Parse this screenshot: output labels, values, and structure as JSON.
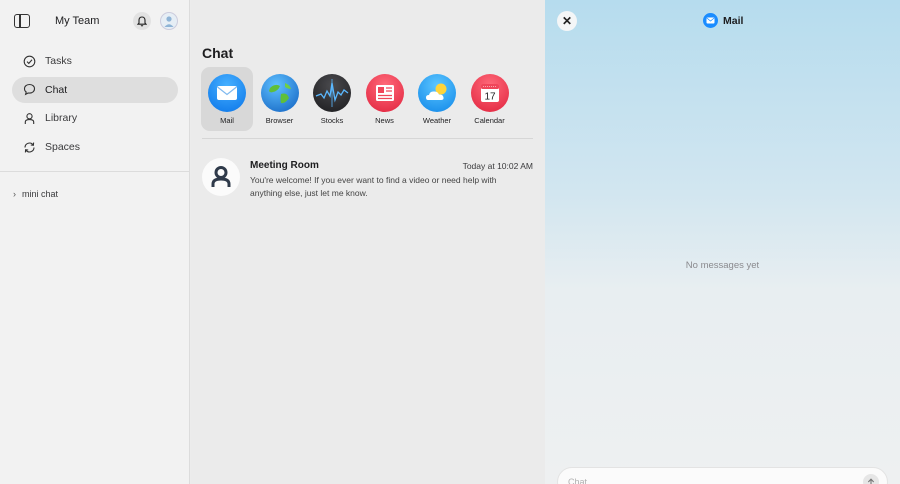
{
  "sidebar": {
    "team_name": "My Team",
    "nav": [
      {
        "label": "Tasks",
        "icon": "check-circle-icon"
      },
      {
        "label": "Chat",
        "icon": "chat-bubble-icon"
      },
      {
        "label": "Library",
        "icon": "person-icon"
      },
      {
        "label": "Spaces",
        "icon": "refresh-icon"
      }
    ],
    "active_index": 1,
    "mini_chat_label": "mini chat"
  },
  "main": {
    "title": "Chat",
    "apps": [
      {
        "label": "Mail",
        "icon": "mail-icon",
        "color": "#1a8cff"
      },
      {
        "label": "Browser",
        "icon": "globe-icon",
        "color": "#1f7fd6"
      },
      {
        "label": "Stocks",
        "icon": "stocks-icon",
        "color": "#2c2c2e"
      },
      {
        "label": "News",
        "icon": "news-icon",
        "color": "#f0465a"
      },
      {
        "label": "Weather",
        "icon": "weather-icon",
        "color": "#1e9bf0"
      },
      {
        "label": "Calendar",
        "icon": "calendar-icon",
        "color": "#f0465a"
      }
    ],
    "selected_app": "Mail",
    "conversation": {
      "name": "Meeting Room",
      "time": "Today at 10:02 AM",
      "message": "You're welcome! If you ever want to find a video or need help with anything else, just let me know."
    }
  },
  "panel": {
    "title": "Mail",
    "empty_text": "No messages yet",
    "composer_placeholder": "Chat"
  },
  "calendar_day": "17",
  "colors": {
    "accent": "#1a8cff",
    "panel_gradient_top": "#b6dcee"
  }
}
